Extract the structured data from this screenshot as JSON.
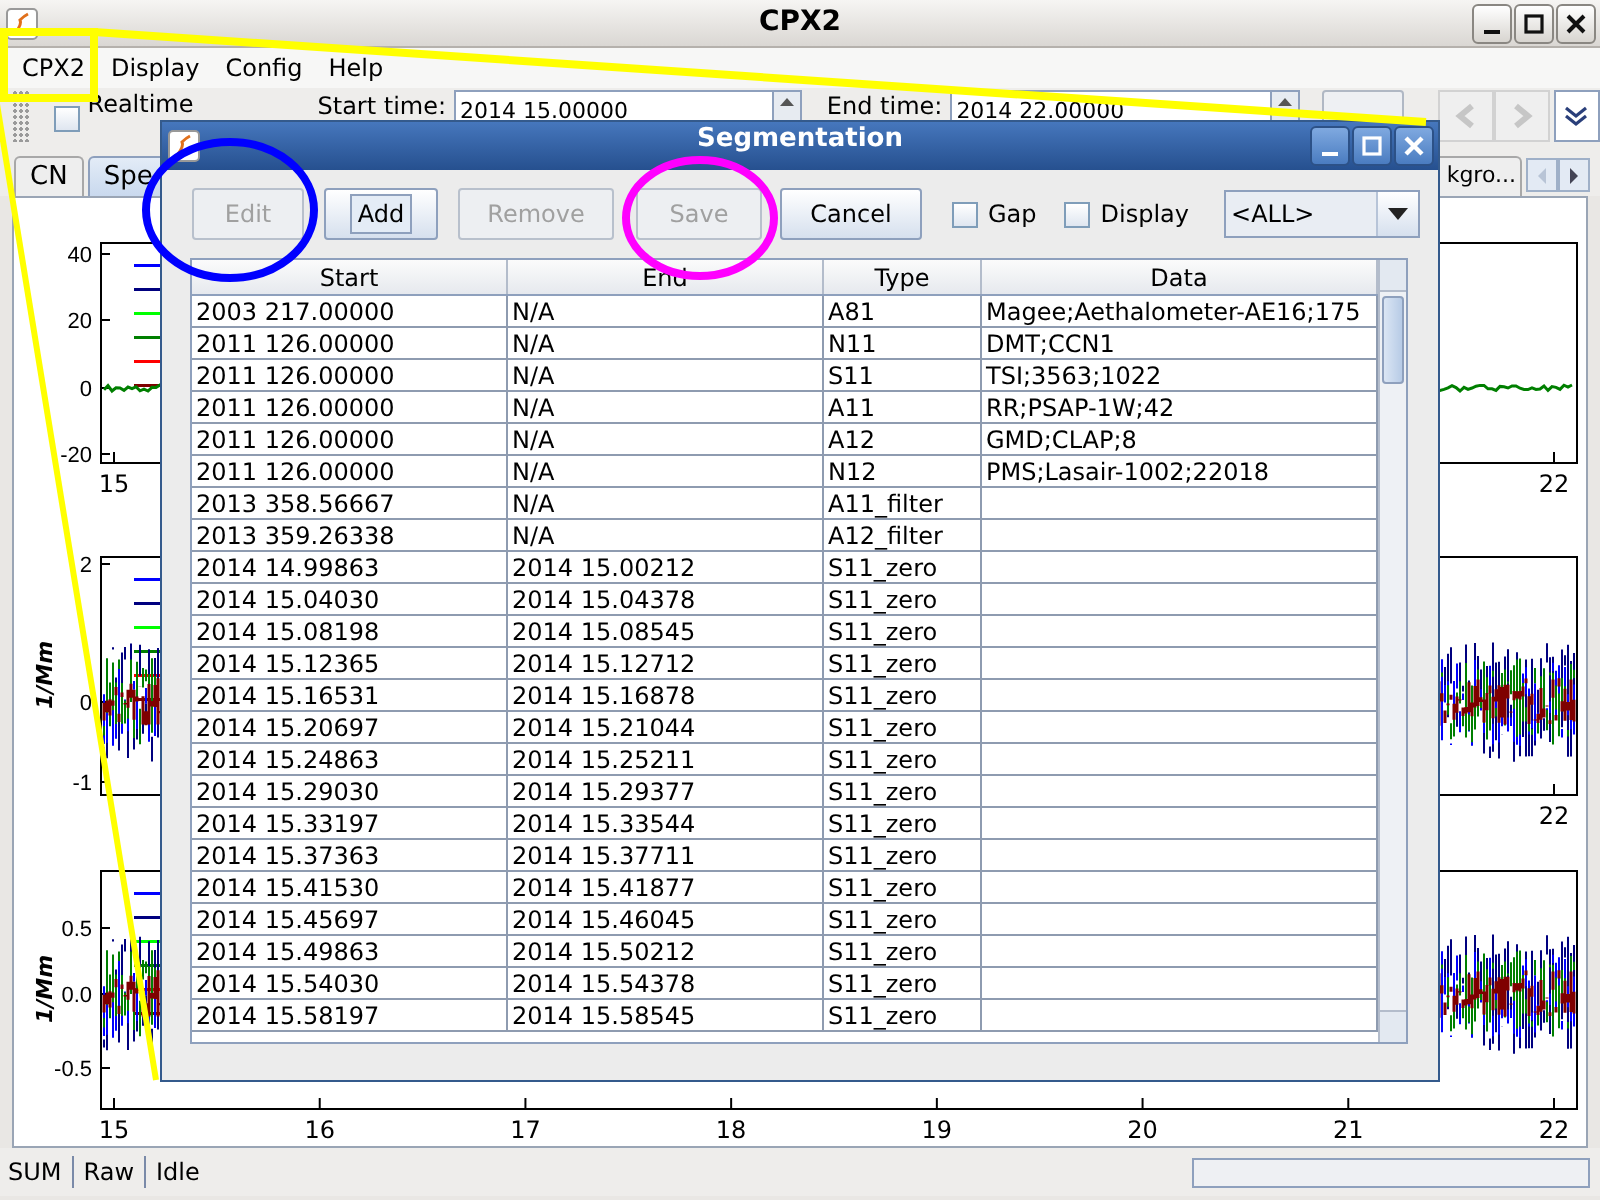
{
  "window": {
    "title": "CPX2"
  },
  "menu": [
    {
      "label": "CPX2"
    },
    {
      "label": "Display"
    },
    {
      "label": "Config"
    },
    {
      "label": "Help"
    }
  ],
  "toolbar": {
    "realtime": {
      "label": "Realtime",
      "checked": false
    },
    "start_time": {
      "label": "Start time:",
      "value": "2014 15.00000"
    },
    "end_time": {
      "label": "End time:",
      "value": "2014 22.00000"
    }
  },
  "tabs": [
    {
      "label": "CN",
      "selected": false
    },
    {
      "label": "Spe",
      "selected": true
    },
    {
      "label": "kgro...",
      "selected": false
    }
  ],
  "plots": [
    {
      "yticks": [
        "40",
        "20",
        "0",
        "-20"
      ],
      "xticks": [
        "15",
        "22"
      ]
    },
    {
      "ylabel": "1/Mm",
      "yticks": [
        "2",
        "0",
        "-1"
      ],
      "xticks": [
        "22"
      ]
    },
    {
      "ylabel": "1/Mm",
      "yticks": [
        "0.5",
        "0.0",
        "-0.5"
      ],
      "xticks": [
        "15",
        "16",
        "17",
        "18",
        "19",
        "20",
        "21",
        "22"
      ]
    }
  ],
  "dialog": {
    "title": "Segmentation",
    "buttons": [
      {
        "label": "Edit",
        "disabled": true,
        "focused": false
      },
      {
        "label": "Add",
        "disabled": false,
        "focused": true
      },
      {
        "label": "Remove",
        "disabled": true,
        "focused": false
      },
      {
        "label": "Save",
        "disabled": true,
        "focused": false
      },
      {
        "label": "Cancel",
        "disabled": false,
        "focused": false
      }
    ],
    "checkboxes": [
      {
        "label": "Gap",
        "checked": false
      },
      {
        "label": "Display",
        "checked": false
      }
    ],
    "filter": {
      "value": "<ALL>"
    },
    "table": {
      "columns": [
        "Start",
        "End",
        "Type",
        "Data"
      ],
      "rows": [
        {
          "start": "2003 217.00000",
          "end": "N/A",
          "type": "A81",
          "data": "Magee;Aethalometer-AE16;175"
        },
        {
          "start": "2011 126.00000",
          "end": "N/A",
          "type": "N11",
          "data": "DMT;CCN1"
        },
        {
          "start": "2011 126.00000",
          "end": "N/A",
          "type": "S11",
          "data": "TSI;3563;1022"
        },
        {
          "start": "2011 126.00000",
          "end": "N/A",
          "type": "A11",
          "data": "RR;PSAP-1W;42"
        },
        {
          "start": "2011 126.00000",
          "end": "N/A",
          "type": "A12",
          "data": "GMD;CLAP;8"
        },
        {
          "start": "2011 126.00000",
          "end": "N/A",
          "type": "N12",
          "data": "PMS;Lasair-1002;22018"
        },
        {
          "start": "2013 358.56667",
          "end": "N/A",
          "type": "A11_filter"
        },
        {
          "start": "2013 359.26338",
          "end": "N/A",
          "type": "A12_filter"
        },
        {
          "start": "2014 14.99863",
          "end": "2014 15.00212",
          "type": "S11_zero"
        },
        {
          "start": "2014 15.04030",
          "end": "2014 15.04378",
          "type": "S11_zero"
        },
        {
          "start": "2014 15.08198",
          "end": "2014 15.08545",
          "type": "S11_zero"
        },
        {
          "start": "2014 15.12365",
          "end": "2014 15.12712",
          "type": "S11_zero"
        },
        {
          "start": "2014 15.16531",
          "end": "2014 15.16878",
          "type": "S11_zero"
        },
        {
          "start": "2014 15.20697",
          "end": "2014 15.21044",
          "type": "S11_zero"
        },
        {
          "start": "2014 15.24863",
          "end": "2014 15.25211",
          "type": "S11_zero"
        },
        {
          "start": "2014 15.29030",
          "end": "2014 15.29377",
          "type": "S11_zero"
        },
        {
          "start": "2014 15.33197",
          "end": "2014 15.33544",
          "type": "S11_zero"
        },
        {
          "start": "2014 15.37363",
          "end": "2014 15.37711",
          "type": "S11_zero"
        },
        {
          "start": "2014 15.41530",
          "end": "2014 15.41877",
          "type": "S11_zero"
        },
        {
          "start": "2014 15.45697",
          "end": "2014 15.46045",
          "type": "S11_zero"
        },
        {
          "start": "2014 15.49863",
          "end": "2014 15.50212",
          "type": "S11_zero"
        },
        {
          "start": "2014 15.54030",
          "end": "2014 15.54378",
          "type": "S11_zero"
        },
        {
          "start": "2014 15.58197",
          "end": "2014 15.58545",
          "type": "S11_zero"
        }
      ]
    }
  },
  "status_bar": [
    "SUM",
    "Raw",
    "Idle"
  ],
  "progress": {
    "level": 0
  }
}
